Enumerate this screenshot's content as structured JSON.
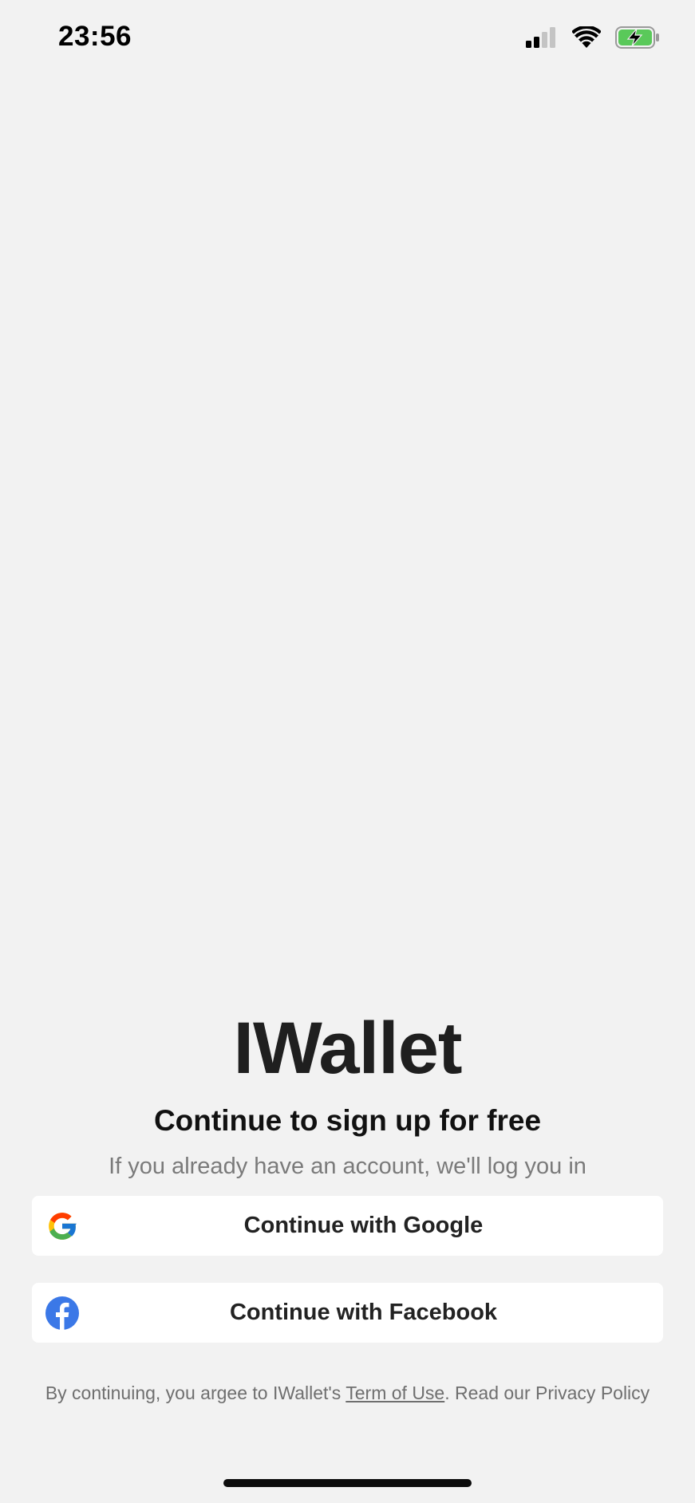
{
  "status_bar": {
    "time": "23:56",
    "icons": [
      "cellular-signal-icon",
      "wifi-icon",
      "battery-charging-icon"
    ],
    "battery_color": "#5ac95a"
  },
  "app": {
    "title": "IWallet"
  },
  "signup": {
    "headline": "Continue to sign up for free",
    "subline": "If you already have an account, we'll log you in"
  },
  "buttons": {
    "google": {
      "label": "Continue with Google",
      "icon": "google-icon"
    },
    "facebook": {
      "label": "Continue with Facebook",
      "icon": "facebook-icon",
      "color": "#3b78e7"
    }
  },
  "legal": {
    "prefix": "By continuing, you argee to IWallet's ",
    "terms_link": "Term of Use",
    "suffix": ". Read our Privacy Policy"
  },
  "colors": {
    "background": "#f2f2f2",
    "button_background": "#ffffff",
    "text_primary": "#1f1f1f",
    "text_secondary": "#7a7a7a"
  }
}
